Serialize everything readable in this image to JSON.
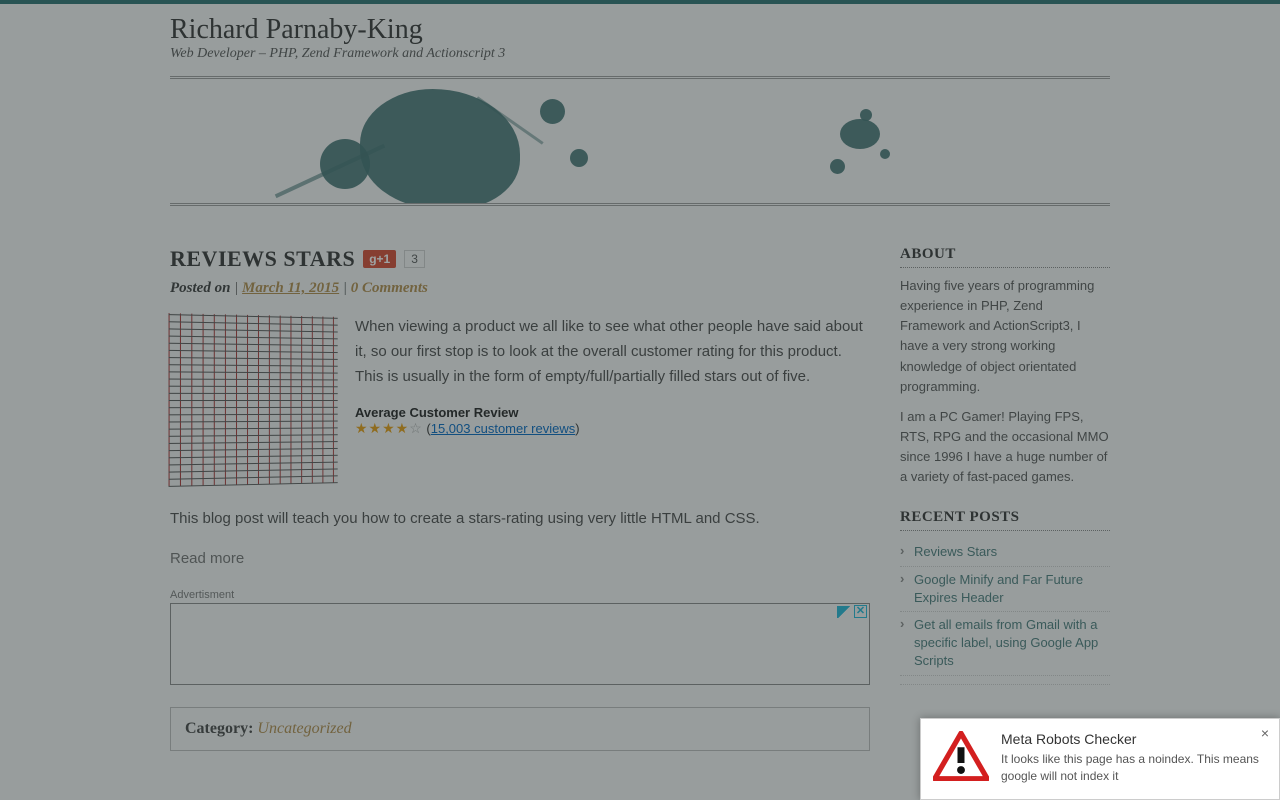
{
  "header": {
    "site_title": "Richard Parnaby-King",
    "site_subtitle": "Web Developer – PHP, Zend Framework and Actionscript 3"
  },
  "post": {
    "title": "REVIEWS STARS",
    "gplus_label": "g+1",
    "gplus_count": "3",
    "meta_prefix": "Posted on",
    "meta_date": "March 11, 2015",
    "meta_comments": "0 Comments",
    "paragraph1": "When viewing a product we all like to see what other people have said about it, so our first stop is to look at the overall customer rating for this product. This is usually in the form of empty/full/partially filled stars out of five.",
    "acr_title": "Average Customer Review",
    "acr_reviews_text": "15,003 customer reviews",
    "paragraph2": "This blog post will teach you how to create a stars-rating using very little HTML and CSS.",
    "read_more": "Read more",
    "ad_label": "Advertisment",
    "category_label": "Category:",
    "category_value": "Uncategorized"
  },
  "sidebar": {
    "about_heading": "ABOUT",
    "about_p1": "Having five years of programming experience in PHP, Zend Framework and ActionScript3, I have a very strong working knowledge of object orientated programming.",
    "about_p2": "I am a PC Gamer! Playing FPS, RTS, RPG and the occasional MMO since 1996 I have a huge number of a variety of fast-paced games.",
    "recent_heading": "RECENT POSTS",
    "recent": [
      "Reviews Stars",
      "Google Minify and Far Future Expires Header",
      "Get all emails from Gmail with a specific label, using Google App Scripts"
    ]
  },
  "toast": {
    "title": "Meta Robots Checker",
    "body": "It looks like this page has a noindex. This means google will not index it",
    "close": "×"
  }
}
